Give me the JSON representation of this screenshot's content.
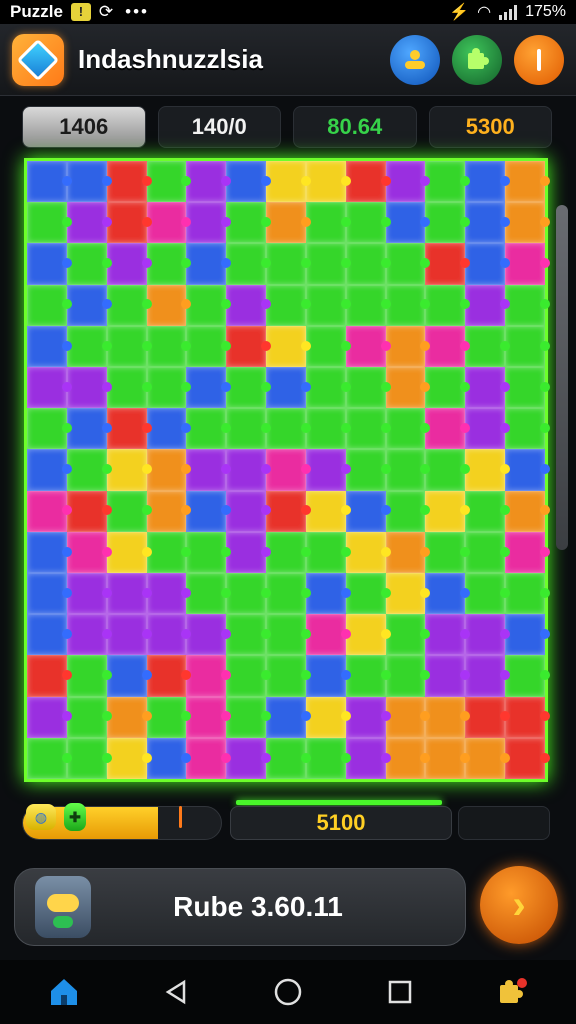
{
  "status_bar": {
    "app_name": "Puzzle",
    "dots": "•••",
    "battery": "175%"
  },
  "header": {
    "title": "Indashnuzzlsia",
    "buttons": [
      {
        "icon": "people-icon",
        "color": "#1a6fe0"
      },
      {
        "icon": "puzzle-icon",
        "color": "#1f8a39"
      },
      {
        "icon": "info-icon",
        "color": "#f07a10"
      }
    ]
  },
  "stats": [
    "1406",
    "140/0",
    "80.64",
    "5300"
  ],
  "board": {
    "columns": 13,
    "rows": 15,
    "colors": {
      "G": "#35d62a",
      "B": "#2f62e6",
      "P": "#9a2fe0",
      "R": "#e8322a",
      "O": "#f0901c",
      "Y": "#f3d11f",
      "M": "#ea2ca0",
      "C": "#1fa6e8"
    },
    "pattern": [
      "BBRGPBYYRPGBO",
      "GPRMPGOGGBGBO",
      "BGPGBGGGGGRBM",
      "GBGOGPGGGGGPG",
      "BGGGGRYGMOMGG",
      "PPGGBGBGGOGPG",
      "GBRBGGGGGGMPG",
      "BGYOPPMPGGGYB",
      "MRGOBPRYBGYGO",
      "BMYGGPGGYOGGM",
      "BPPPGGGBGYBGG",
      "BPPPPGGMYGPPB",
      "RGBRMGGBGGPPG",
      "PGOGMGBYPOORR",
      "GGYBMPGGPOOOR"
    ]
  },
  "progress": {
    "fill_fraction": 0.68,
    "icon1": "globe-icon",
    "icon2": "puzzle-piece-icon"
  },
  "score": "5100",
  "card": {
    "label": "Rube 3.60.11",
    "mascot": "mascot-icon"
  },
  "play_button": {
    "icon": "chevron-right-icon"
  },
  "nav": [
    "home-icon",
    "back-icon",
    "home-circle-icon",
    "recents-icon",
    "puzzle-settings-icon"
  ]
}
